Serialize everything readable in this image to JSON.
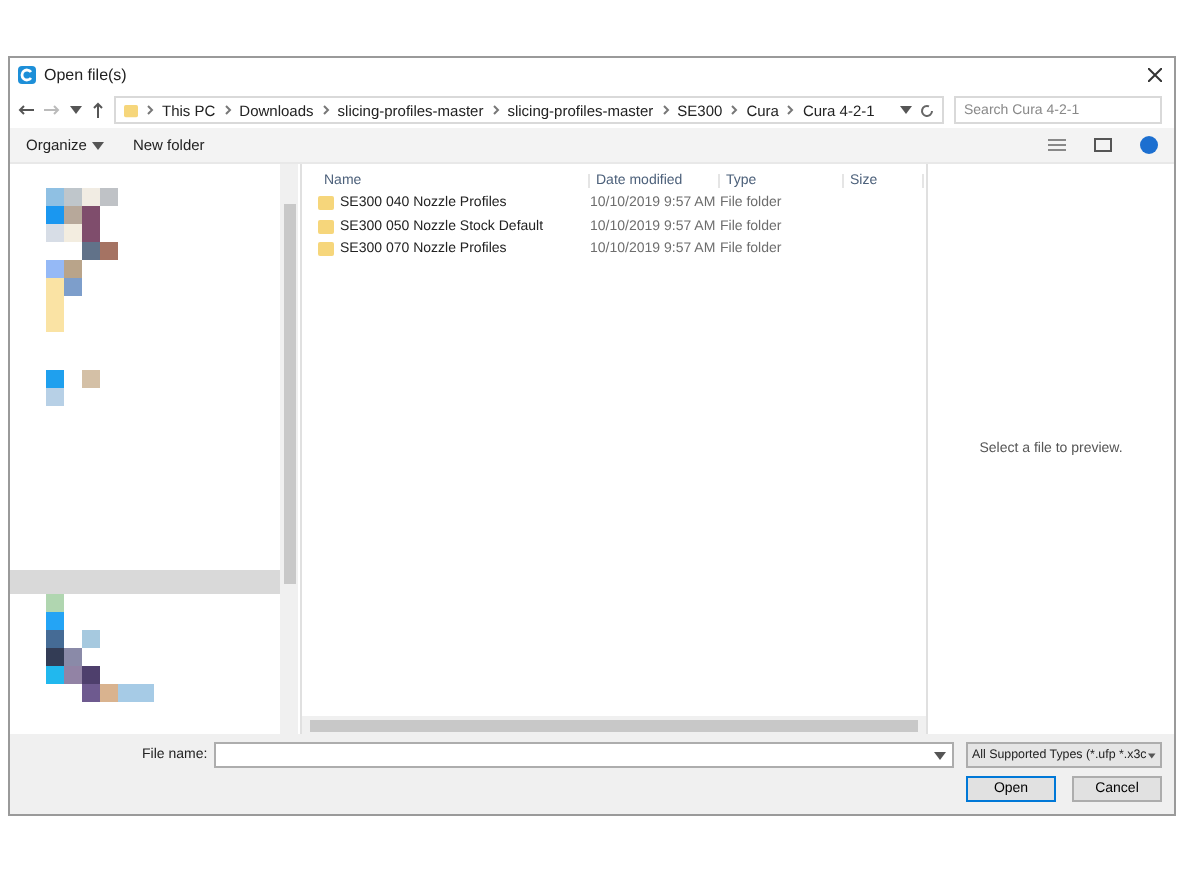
{
  "window": {
    "title": "Open file(s)"
  },
  "breadcrumb": [
    "This PC",
    "Downloads",
    "slicing-profiles-master",
    "slicing-profiles-master",
    "SE300",
    "Cura",
    "Cura 4-2-1"
  ],
  "search": {
    "placeholder": "Search Cura 4-2-1"
  },
  "toolbar": {
    "organize": "Organize",
    "new_folder": "New folder"
  },
  "columns": [
    "Name",
    "Date modified",
    "Type",
    "Size"
  ],
  "files": [
    {
      "name": "SE300 040 Nozzle Profiles",
      "date": "10/10/2019 9:57 AM",
      "type": "File folder"
    },
    {
      "name": "SE300 050 Nozzle Stock Default",
      "date": "10/10/2019 9:57 AM",
      "type": "File folder"
    },
    {
      "name": "SE300 070 Nozzle Profiles",
      "date": "10/10/2019 9:57 AM",
      "type": "File folder"
    }
  ],
  "preview": {
    "message": "Select a file to preview."
  },
  "file_name": {
    "label": "File name:"
  },
  "file_type": {
    "value": "All Supported Types (*.ufp *.x3c"
  },
  "buttons": [
    {
      "label": "Open",
      "default": true
    },
    {
      "label": "Cancel",
      "default": false
    }
  ]
}
